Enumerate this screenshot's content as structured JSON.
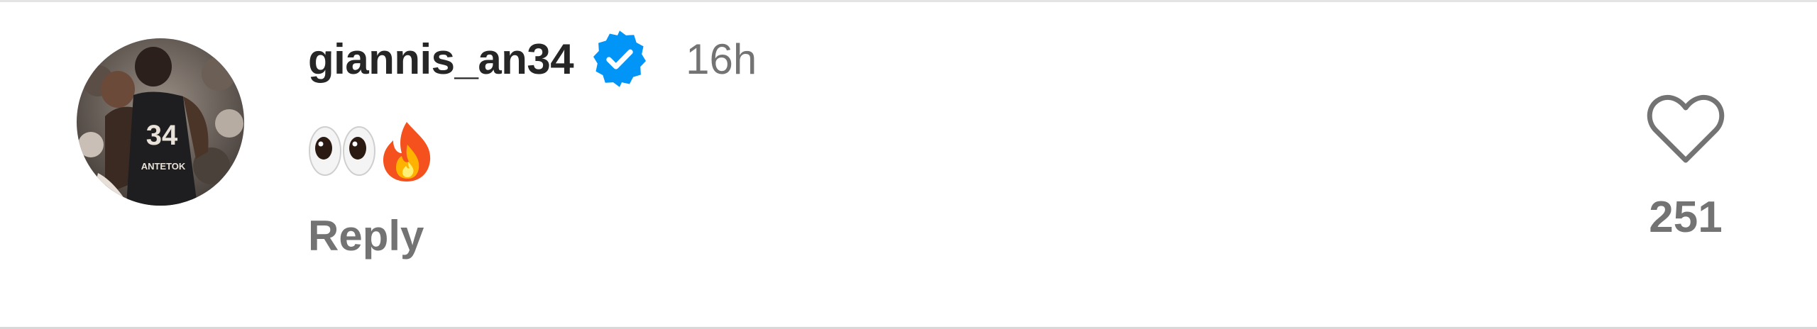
{
  "comment": {
    "author": {
      "username": "giannis_an34",
      "verified": true,
      "avatar_icon": "profile-photo-basketball-player-jersey-34"
    },
    "timestamp": "16h",
    "text_emojis": [
      "eyes",
      "fire"
    ],
    "actions": {
      "reply_label": "Reply"
    },
    "likes": {
      "count": "251",
      "icon": "heart-outline-icon"
    }
  },
  "colors": {
    "username": "#262626",
    "secondary_text": "#737373",
    "verified_badge": "#0095f6",
    "background": "#ffffff"
  }
}
